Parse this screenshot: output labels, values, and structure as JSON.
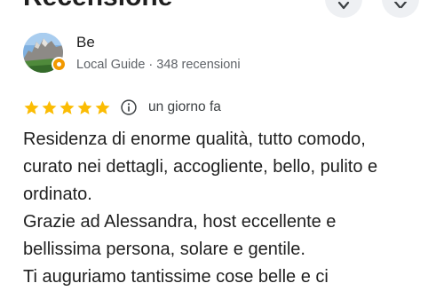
{
  "header": {
    "title": "Recensione"
  },
  "author": {
    "name": "Be",
    "meta": "Local Guide · 348 recensioni",
    "avatar_icon": "mountain-landscape-photo",
    "badge_icon": "local-guide-badge-icon"
  },
  "review": {
    "rating": 5,
    "rating_max": 5,
    "time": "un giorno fa",
    "lines": [
      "Residenza di enorme qualità, tutto comodo,",
      "curato nei dettagli, accogliente, bello, pulito e",
      "ordinato.",
      "Grazie ad Alessandra, host eccellente e",
      "bellissima persona, solare e gentile.",
      "Ti auguriamo tantissime cose belle e ci"
    ]
  },
  "colors": {
    "star": "#fbbc04",
    "badge": "#f29900",
    "button_bg": "#eef0f3",
    "secondary_text": "#5f6368"
  }
}
